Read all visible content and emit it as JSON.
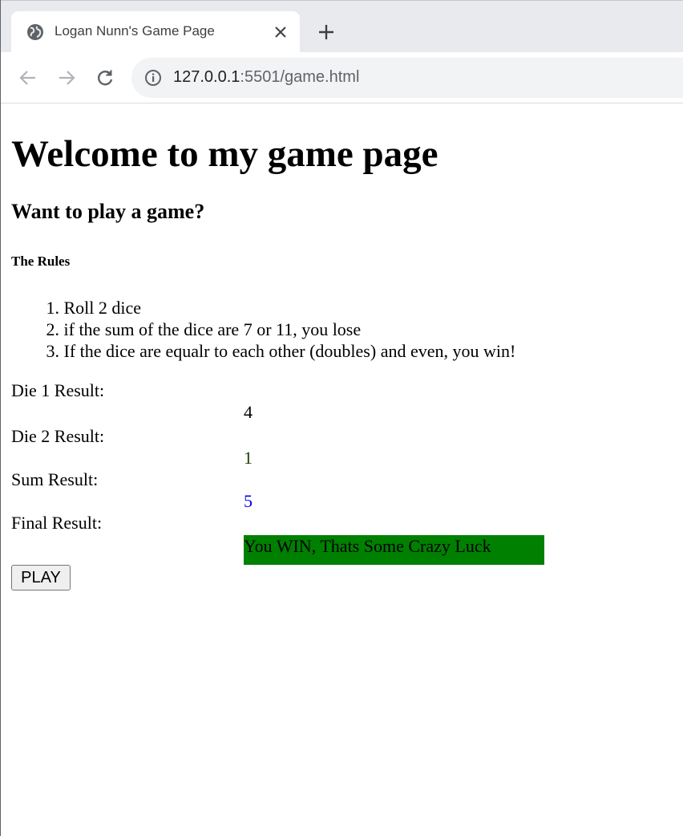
{
  "browser": {
    "tab_title": "Logan Nunn's Game Page",
    "url_host": "127.0.0.1",
    "url_rest": ":5501/game.html"
  },
  "page": {
    "heading": "Welcome to my game page",
    "subheading": "Want to play a game?",
    "rules_title": "The Rules",
    "rules": [
      {
        "number": "1.",
        "text": "Roll 2 dice"
      },
      {
        "number": "2.",
        "text": "if the sum of the dice are 7 or 11, you lose"
      },
      {
        "number": "3.",
        "text": "If the dice are equalr to each other (doubles) and even, you win!"
      }
    ],
    "results": {
      "die1_label": "Die 1 Result:",
      "die1_value": "4",
      "die2_label": "Die 2 Result:",
      "die2_value": "1",
      "sum_label": "Sum Result:",
      "sum_value": "5",
      "final_label": "Final Result:",
      "final_value": "You WIN, Thats Some Crazy Luck"
    },
    "play_button": "PLAY"
  },
  "colors": {
    "die2_value": "#1e3d0a",
    "sum_value": "#0000ee",
    "final_background": "#008000"
  },
  "icons": [
    "globe-icon",
    "close-icon",
    "plus-icon",
    "back-arrow-icon",
    "forward-arrow-icon",
    "reload-icon",
    "info-icon"
  ]
}
